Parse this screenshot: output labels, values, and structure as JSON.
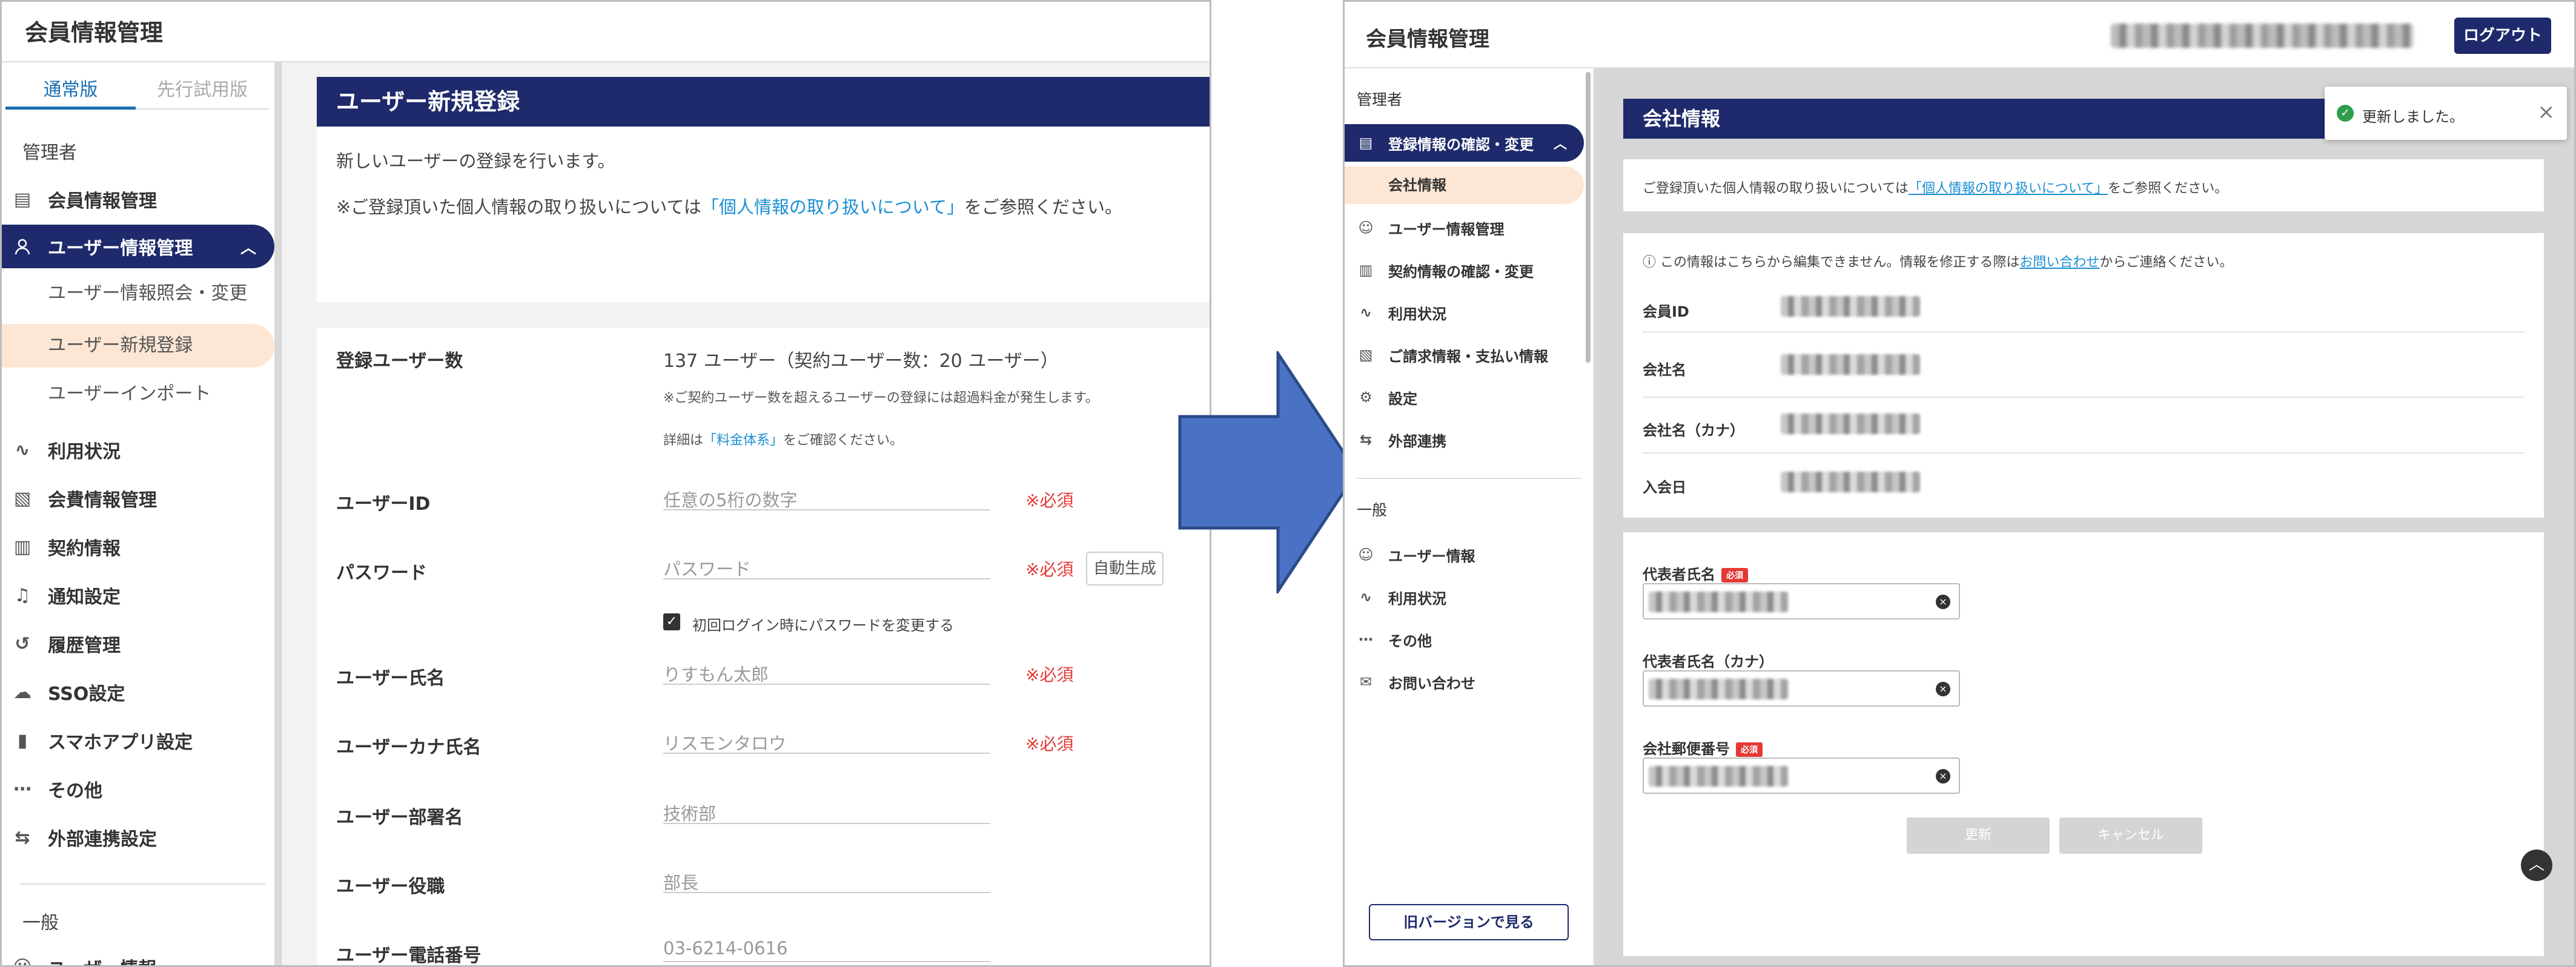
{
  "colors": {
    "navy": "#1e2a6b",
    "link": "#1a8fd4",
    "required_red": "#e53935",
    "active_sub_bg": "#fde6d4",
    "arrow_blue": "#4a72c4",
    "success_green": "#2e9d4c"
  },
  "left": {
    "app_title": "会員情報管理",
    "tabs": [
      {
        "label": "通常版",
        "active": true
      },
      {
        "label": "先行試用版",
        "active": false
      }
    ],
    "sidebar": {
      "section_admin": "管理者",
      "section_general": "一般",
      "items": [
        {
          "label": "会員情報管理",
          "icon": "building-icon"
        },
        {
          "label": "ユーザー情報管理",
          "icon": "user-icon",
          "active": true
        },
        {
          "label": "利用状況",
          "icon": "activity-icon"
        },
        {
          "label": "会費情報管理",
          "icon": "invoice-icon"
        },
        {
          "label": "契約情報",
          "icon": "document-icon"
        },
        {
          "label": "通知設定",
          "icon": "bell-icon"
        },
        {
          "label": "履歴管理",
          "icon": "history-icon"
        },
        {
          "label": "SSO設定",
          "icon": "cloud-icon"
        },
        {
          "label": "スマホアプリ設定",
          "icon": "phone-icon"
        },
        {
          "label": "その他",
          "icon": "more-icon"
        },
        {
          "label": "外部連携設定",
          "icon": "link-icon"
        },
        {
          "label": "ユーザー情報",
          "icon": "user-icon"
        }
      ],
      "subitems": [
        {
          "label": "ユーザー情報照会・変更"
        },
        {
          "label": "ユーザー新規登録",
          "active": true
        },
        {
          "label": "ユーザーインポート"
        }
      ]
    },
    "header": "ユーザー新規登録",
    "intro_line1": "新しいユーザーの登録を行います。",
    "intro_line2_pre": "※ご登録頂いた個人情報の取り扱いについては",
    "intro_line2_link": "「個人情報の取り扱いについて」",
    "intro_line2_post": "をご参照ください。",
    "form": {
      "user_count_label": "登録ユーザー数",
      "user_count_value": "137 ユーザー（契約ユーザー数：20 ユーザー）",
      "user_count_note1": "※ご契約ユーザー数を超えるユーザーの登録には超過料金が発生します。",
      "user_count_note2_pre": "詳細は",
      "user_count_note2_link": "「料金体系」",
      "user_count_note2_post": "をご確認ください。",
      "required": "※必須",
      "fields": [
        {
          "label": "ユーザーID",
          "placeholder": "任意の5桁の数字",
          "required": true
        },
        {
          "label": "パスワード",
          "placeholder": "パスワード",
          "required": true
        },
        {
          "label": "ユーザー氏名",
          "placeholder": "りすもん太郎",
          "required": true
        },
        {
          "label": "ユーザーカナ氏名",
          "placeholder": "リスモンタロウ",
          "required": true
        },
        {
          "label": "ユーザー部署名",
          "placeholder": "技術部",
          "required": false
        },
        {
          "label": "ユーザー役職",
          "placeholder": "部長",
          "required": false
        },
        {
          "label": "ユーザー電話番号",
          "placeholder": "03-6214-0616",
          "required": false
        }
      ],
      "auto_generate": "自動生成",
      "change_password_checkbox": "初回ログイン時にパスワードを変更する",
      "change_password_checked": true
    }
  },
  "right": {
    "app_title": "会員情報管理",
    "logout": "ログアウト",
    "sidebar": {
      "section_admin": "管理者",
      "section_general": "一般",
      "admin_items": [
        {
          "label": "登録情報の確認・変更",
          "icon": "building-icon",
          "active": true
        },
        {
          "label": "ユーザー情報管理",
          "icon": "user-icon"
        },
        {
          "label": "契約情報の確認・変更",
          "icon": "document-icon"
        },
        {
          "label": "利用状況",
          "icon": "activity-icon"
        },
        {
          "label": "ご請求情報・支払い情報",
          "icon": "invoice-icon"
        },
        {
          "label": "設定",
          "icon": "gear-icon"
        },
        {
          "label": "外部連携",
          "icon": "link-icon"
        }
      ],
      "active_sub": "会社情報",
      "general_items": [
        {
          "label": "ユーザー情報",
          "icon": "user-icon"
        },
        {
          "label": "利用状況",
          "icon": "activity-icon"
        },
        {
          "label": "その他",
          "icon": "more-icon"
        },
        {
          "label": "お問い合わせ",
          "icon": "chat-icon"
        }
      ],
      "old_version_button": "旧バージョンで見る"
    },
    "header": "会社情報",
    "privacy_pre": "ご登録頂いた個人情報の取り扱いについては",
    "privacy_link": "「個人情報の取り扱いについて」",
    "privacy_post": "をご参照ください。",
    "info_notice_pre": "この情報はこちらから編集できません。情報を修正する際は",
    "info_notice_link": "お問い合わせ",
    "info_notice_post": "からご連絡ください。",
    "readonly_labels": [
      "会員ID",
      "会社名",
      "会社名（カナ）",
      "入会日"
    ],
    "edit_labels": [
      "代表者氏名",
      "代表者氏名（カナ）",
      "会社郵便番号"
    ],
    "required_badge": "必須",
    "update_button": "更新",
    "cancel_button": "キャンセル",
    "toast_message": "更新しました。"
  }
}
